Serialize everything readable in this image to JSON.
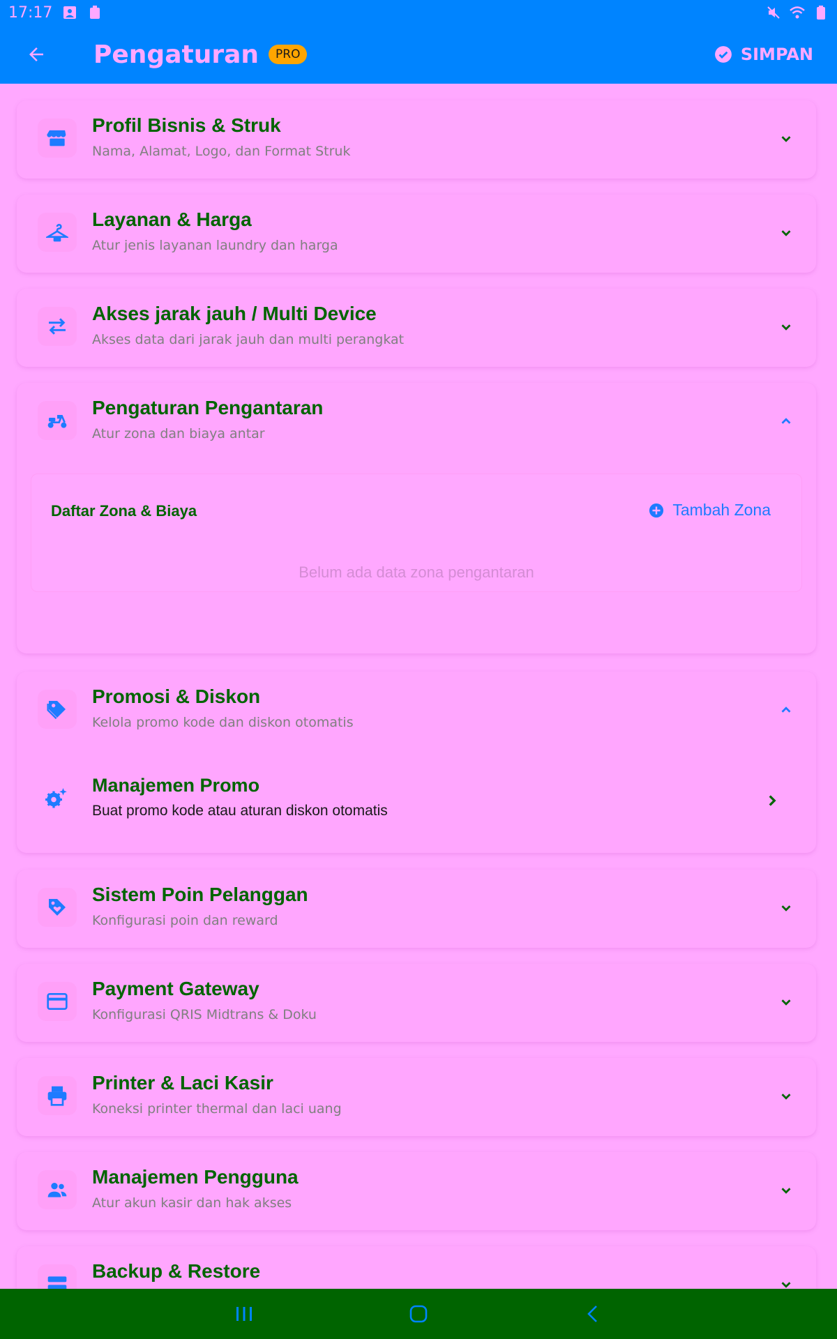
{
  "status_bar": {
    "time": "17:17"
  },
  "app_bar": {
    "title": "Pengaturan",
    "badge": "PRO",
    "save_label": "SIMPAN"
  },
  "sections": [
    {
      "title": "Profil Bisnis & Struk",
      "subtitle": "Nama, Alamat, Logo, dan Format Struk",
      "icon": "store-icon",
      "expanded": false
    },
    {
      "title": "Layanan & Harga",
      "subtitle": "Atur jenis layanan laundry dan harga",
      "icon": "hanger-icon",
      "expanded": false
    },
    {
      "title": "Akses jarak jauh / Multi Device",
      "subtitle": "Akses data dari jarak jauh dan multi perangkat",
      "icon": "swap-arrows-icon",
      "expanded": false
    },
    {
      "title": "Pengaturan Pengantaran",
      "subtitle": "Atur zona dan biaya antar",
      "icon": "scooter-icon",
      "expanded": true
    },
    {
      "title": "Promosi & Diskon",
      "subtitle": "Kelola promo kode dan diskon otomatis",
      "icon": "tag-icon",
      "expanded": true
    },
    {
      "title": "Sistem Poin Pelanggan",
      "subtitle": "Konfigurasi poin dan reward",
      "icon": "loyalty-icon",
      "expanded": false
    },
    {
      "title": "Payment Gateway",
      "subtitle": "Konfigurasi QRIS Midtrans & Doku",
      "icon": "credit-card-icon",
      "expanded": false
    },
    {
      "title": "Printer & Laci Kasir",
      "subtitle": "Koneksi printer thermal dan laci uang",
      "icon": "printer-icon",
      "expanded": false
    },
    {
      "title": "Manajemen Pengguna",
      "subtitle": "Atur akun kasir dan hak akses",
      "icon": "users-icon",
      "expanded": false
    },
    {
      "title": "Backup & Restore",
      "subtitle": "",
      "icon": "backup-icon",
      "expanded": false
    }
  ],
  "delivery": {
    "zone_list_title": "Daftar Zona & Biaya",
    "add_zone_label": "Tambah Zona",
    "empty_text": "Belum ada data zona pengantaran"
  },
  "promo": {
    "item_title": "Manajemen Promo",
    "item_subtitle": "Buat promo kode atau aturan diskon otomatis"
  },
  "colors": {
    "primary": "#0084FF",
    "background": "#FFA8FF",
    "title_text": "#006400",
    "badge": "#FFA500",
    "nav_bar": "#006400"
  }
}
